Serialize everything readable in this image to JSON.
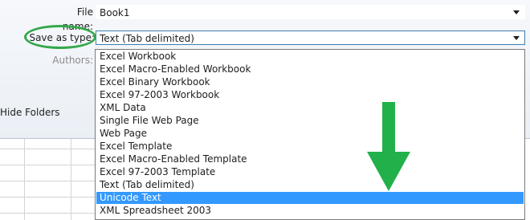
{
  "dialog": {
    "file_name_label": "File name:",
    "file_name_value": "Book1",
    "save_as_type_label": "Save as type:",
    "save_as_type_value": "Text (Tab delimited)",
    "authors_label": "Authors:",
    "hide_folders_label": "Hide Folders"
  },
  "dropdown": {
    "items": [
      "Excel Workbook",
      "Excel Macro-Enabled Workbook",
      "Excel Binary Workbook",
      "Excel 97-2003 Workbook",
      "XML Data",
      "Single File Web Page",
      "Web Page",
      "Excel Template",
      "Excel Macro-Enabled Template",
      "Excel 97-2003 Template",
      "Text (Tab delimited)",
      "Unicode Text",
      "XML Spreadsheet 2003"
    ],
    "selected_item": "Unicode Text"
  },
  "annotations": {
    "highlight_color": "#34a84c",
    "arrow_color": "#22b04b",
    "selection_color": "#3399ff"
  }
}
